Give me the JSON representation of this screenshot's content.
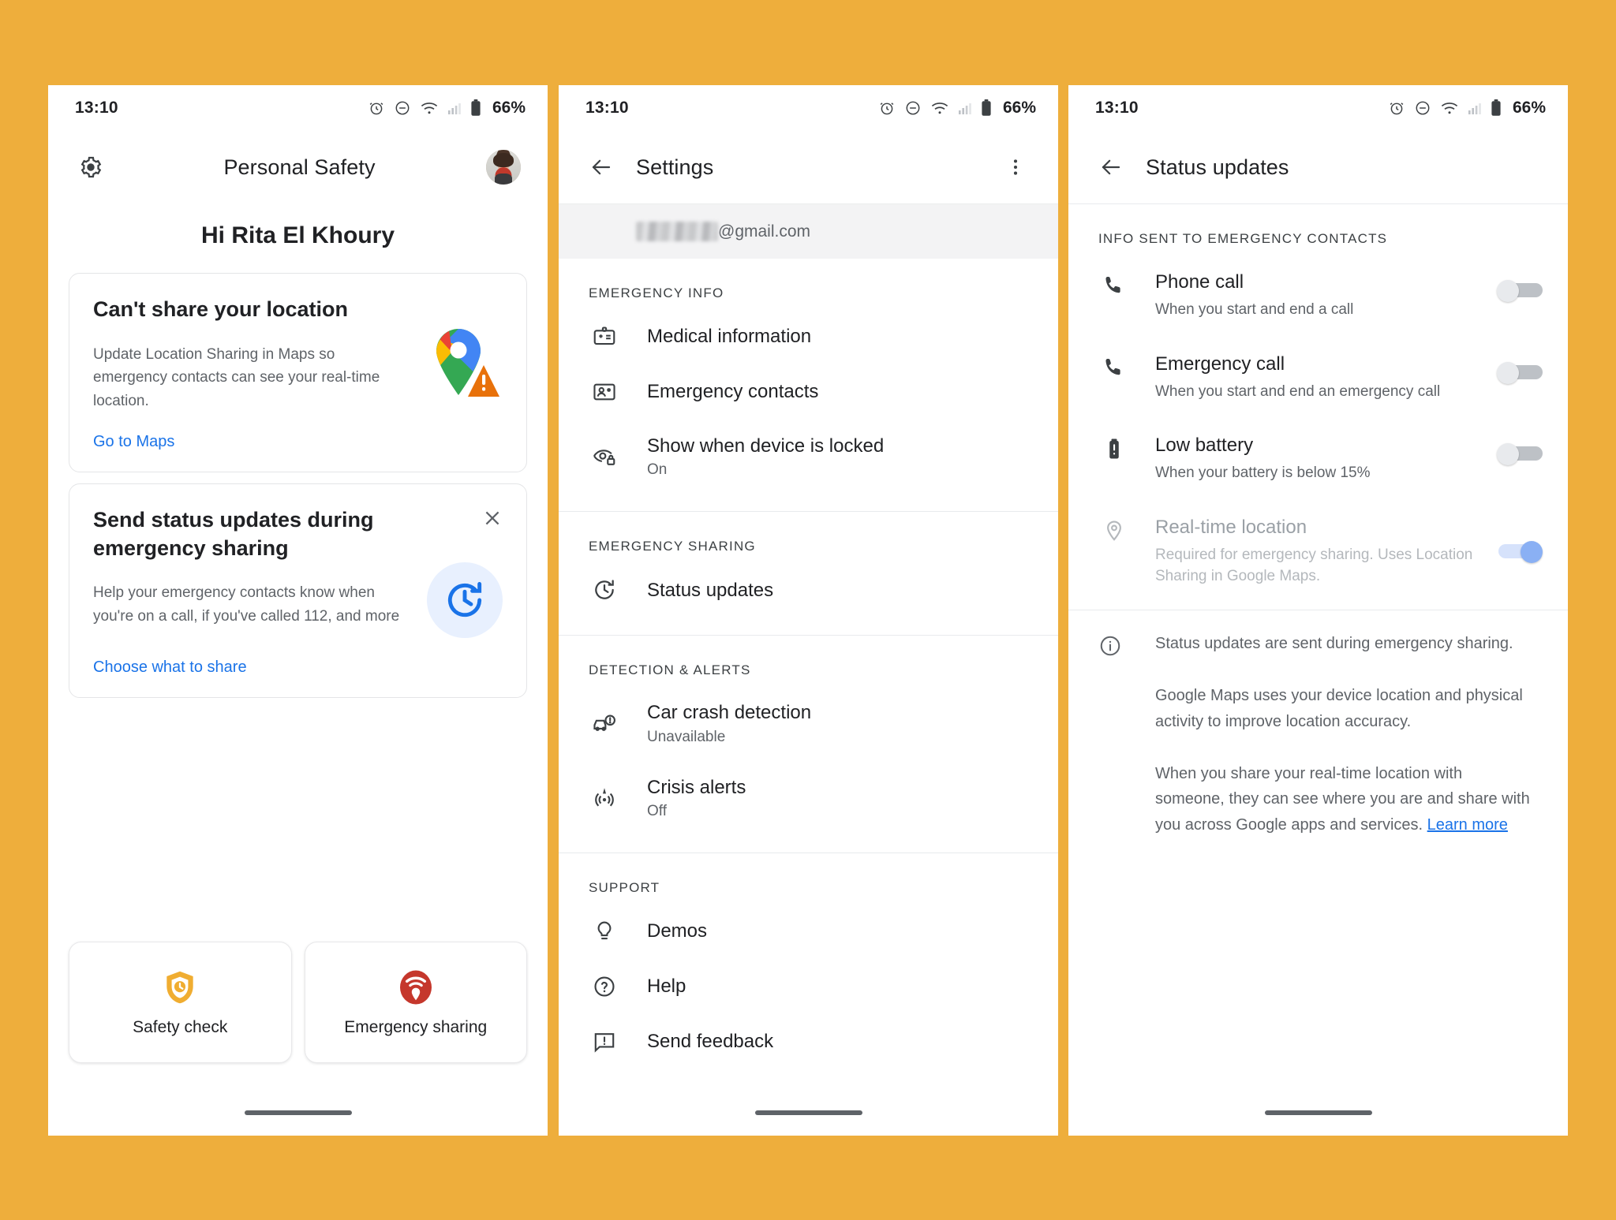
{
  "background_color": "#eeae3c",
  "statusbar": {
    "time": "13:10",
    "battery": "66%",
    "icons": [
      "alarm-icon",
      "do-not-disturb-icon",
      "wifi-icon",
      "signal-icon",
      "battery-icon"
    ]
  },
  "screen1": {
    "settings_icon": "gear-icon",
    "title": "Personal Safety",
    "avatar": "user-avatar",
    "greeting": "Hi Rita El Khoury",
    "card_location": {
      "title": "Can't share your location",
      "body": "Update Location Sharing in Maps so emergency contacts can see your real-time location.",
      "link": "Go to Maps",
      "art": "google-maps-pin-warning-icon"
    },
    "card_status": {
      "title": "Send status updates during emergency sharing",
      "body": "Help your emergency contacts know when you're on a call, if you've called 112, and more",
      "link": "Choose what to share",
      "art": "history-clock-icon",
      "close": "close-icon"
    },
    "tiles": [
      {
        "label": "Safety check",
        "icon": "shield-clock-icon",
        "color": "#f0ad31"
      },
      {
        "label": "Emergency sharing",
        "icon": "emergency-broadcast-pin-icon",
        "color": "#c5372c"
      }
    ]
  },
  "screen2": {
    "back_icon": "back-arrow-icon",
    "title": "Settings",
    "overflow_icon": "more-vert-icon",
    "account": {
      "masked": "",
      "domain": "@gmail.com"
    },
    "sections": [
      {
        "header": "EMERGENCY INFO",
        "items": [
          {
            "icon": "medical-id-card-icon",
            "title": "Medical information",
            "sub": ""
          },
          {
            "icon": "emergency-contact-icon",
            "title": "Emergency contacts",
            "sub": ""
          },
          {
            "icon": "eye-lock-icon",
            "title": "Show when device is locked",
            "sub": "On"
          }
        ]
      },
      {
        "header": "EMERGENCY SHARING",
        "items": [
          {
            "icon": "history-clock-icon",
            "title": "Status updates",
            "sub": ""
          }
        ]
      },
      {
        "header": "DETECTION & ALERTS",
        "items": [
          {
            "icon": "car-crash-icon",
            "title": "Car crash detection",
            "sub": "Unavailable"
          },
          {
            "icon": "crisis-alert-icon",
            "title": "Crisis alerts",
            "sub": "Off"
          }
        ]
      },
      {
        "header": "SUPPORT",
        "items": [
          {
            "icon": "lightbulb-icon",
            "title": "Demos",
            "sub": ""
          },
          {
            "icon": "help-circle-icon",
            "title": "Help",
            "sub": ""
          },
          {
            "icon": "feedback-icon",
            "title": "Send feedback",
            "sub": ""
          }
        ]
      }
    ]
  },
  "screen3": {
    "back_icon": "back-arrow-icon",
    "title": "Status updates",
    "section_header": "INFO SENT TO EMERGENCY CONTACTS",
    "rows": [
      {
        "icon": "phone-call-icon",
        "title": "Phone call",
        "sub": "When you start and end a call",
        "toggle": "off",
        "disabled": false
      },
      {
        "icon": "phone-call-icon",
        "title": "Emergency call",
        "sub": "When you start and end an emergency call",
        "toggle": "off",
        "disabled": false
      },
      {
        "icon": "battery-low-icon",
        "title": "Low battery",
        "sub": "When your battery is below 15%",
        "toggle": "off",
        "disabled": false
      },
      {
        "icon": "location-pin-icon",
        "title": "Real-time location",
        "sub": "Required for emergency sharing. Uses Location Sharing in Google Maps.",
        "toggle": "on",
        "disabled": true
      }
    ],
    "info": {
      "icon": "info-circle-icon",
      "paragraph1": "Status updates are sent during emergency sharing.",
      "paragraph2": "Google Maps uses your device location and physical activity to improve location accuracy.",
      "paragraph3": "When you share your real-time location with someone, they can see where you are and share with you across Google apps and services. ",
      "link": "Learn more"
    }
  }
}
